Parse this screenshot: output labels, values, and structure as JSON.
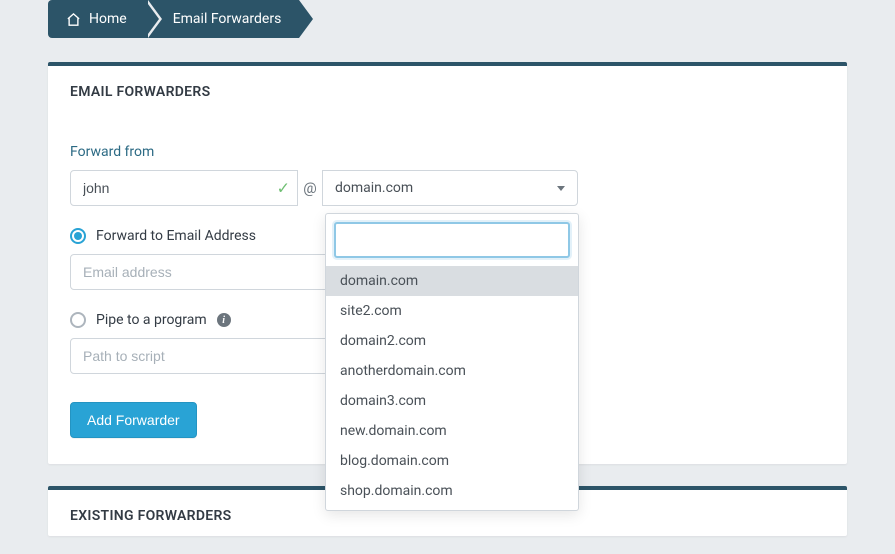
{
  "breadcrumb": {
    "home": "Home",
    "current": "Email Forwarders"
  },
  "panel1": {
    "title": "EMAIL FORWARDERS",
    "forward_from_label": "Forward from",
    "from_value": "john",
    "at": "@",
    "domain_selected": "domain.com",
    "radio_forward_label": "Forward to Email Address",
    "email_placeholder": "Email address",
    "radio_pipe_label": "Pipe to a program",
    "script_placeholder": "Path to script",
    "submit_label": "Add Forwarder"
  },
  "dropdown": {
    "search_value": "",
    "options": [
      "domain.com",
      "site2.com",
      "domain2.com",
      "anotherdomain.com",
      "domain3.com",
      "new.domain.com",
      "blog.domain.com",
      "shop.domain.com"
    ]
  },
  "panel2": {
    "title": "EXISTING FORWARDERS"
  }
}
